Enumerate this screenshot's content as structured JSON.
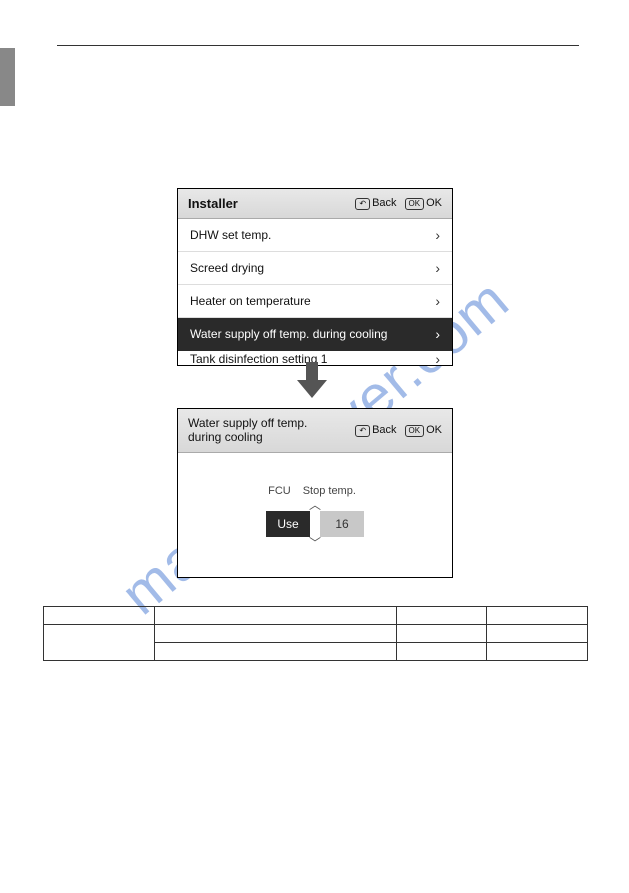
{
  "watermark": "manualshiver.com",
  "panel1": {
    "title": "Installer",
    "back_icon_label": "↶",
    "back_label": "Back",
    "ok_icon_label": "OK",
    "ok_label": "OK",
    "items": [
      {
        "label": "DHW set temp.",
        "selected": false
      },
      {
        "label": "Screed drying",
        "selected": false
      },
      {
        "label": "Heater on temperature",
        "selected": false
      },
      {
        "label": "Water supply off temp. during cooling",
        "selected": true
      },
      {
        "label": "Tank disinfection setting 1",
        "selected": false
      }
    ]
  },
  "panel2": {
    "title": "Water supply off temp.\nduring cooling",
    "back_icon_label": "↶",
    "back_label": "Back",
    "ok_icon_label": "OK",
    "ok_label": "OK",
    "col1_label": "FCU",
    "col2_label": "Stop temp.",
    "caret_up": "︿",
    "caret_down": "﹀",
    "use_label": "Use",
    "value": "16"
  },
  "table": {
    "rows": 3,
    "cols": 4
  }
}
